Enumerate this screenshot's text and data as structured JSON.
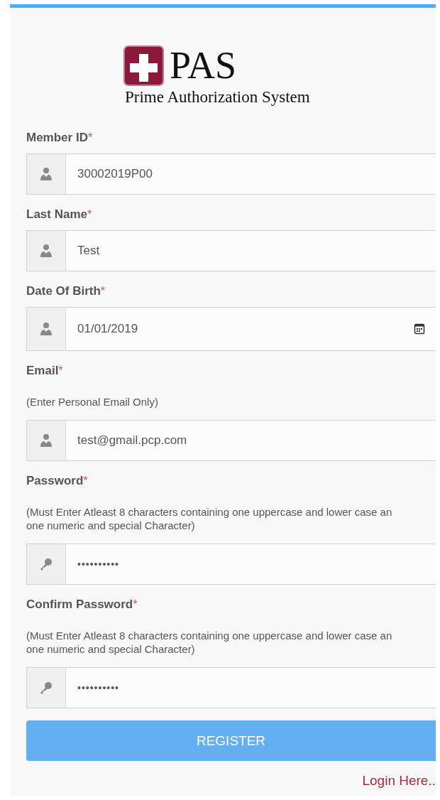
{
  "logo": {
    "title": "PAS",
    "subtitle": "Prime Authorization System"
  },
  "fields": [
    {
      "label": "Member ID",
      "required_mark": "*",
      "kind": "text",
      "value": "30002019P00"
    },
    {
      "label": "Last Name",
      "required_mark": "*",
      "kind": "text",
      "value": "Test"
    },
    {
      "label": "Date Of Birth",
      "required_mark": "*",
      "kind": "date",
      "value": "01/01/2019"
    },
    {
      "label": "Email",
      "required_mark": "*",
      "hint_lines": [
        "(Enter Personal Email Only)"
      ],
      "kind": "text",
      "value": "test@gmail.pcp.com"
    },
    {
      "label": "Password",
      "required_mark": "*",
      "hint_lines": [
        "(Must Enter Atleast 8 characters containing one uppercase and lower case an",
        "one numeric and special Character)"
      ],
      "kind": "password",
      "value": "••••••••••"
    },
    {
      "label": "Confirm Password",
      "required_mark": "*",
      "hint_lines": [
        "(Must Enter Atleast 8 characters containing one uppercase and lower case an",
        "one numeric and special Character)"
      ],
      "kind": "password",
      "value": "••••••••••"
    }
  ],
  "register_button": "REGISTER",
  "login_link": "Login Here.."
}
